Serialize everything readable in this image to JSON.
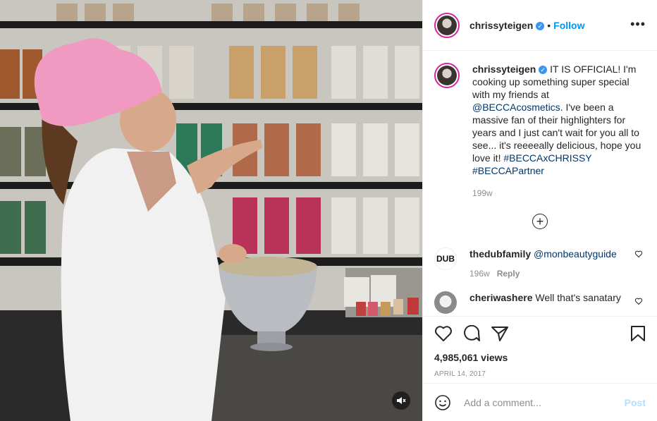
{
  "header": {
    "username": "chrissyteigen",
    "separator": "•",
    "follow_label": "Follow",
    "more_label": "•••"
  },
  "caption": {
    "username": "chrissyteigen",
    "text_1": "IT IS OFFICIAL! I'm cooking up something super special with my friends at ",
    "mention": "@BECCAcosmetics",
    "text_2": ". I've been a massive fan of their highlighters for years and I just can't wait for you all to see... it's reeeeally delicious, hope you love it!",
    "hashtag_1": "#BECCAxCHRISSY",
    "hashtag_2": "#BECCAPartner",
    "time": "199w"
  },
  "load_more_label": "+",
  "comments": [
    {
      "username": "thedubfamily",
      "avatar_text": "DUB",
      "mention": "@monbeautyguide",
      "time": "196w",
      "reply_label": "Reply"
    },
    {
      "username": "cheriwashere",
      "text": "Well that's sanatary"
    }
  ],
  "stats": {
    "views": "4,985,061 views",
    "date": "APRIL 14, 2017"
  },
  "add_comment": {
    "placeholder": "Add a comment...",
    "post_label": "Post"
  },
  "colors": {
    "accent": "#0095f6",
    "verified": "#3897f0",
    "muted": "#8e8e8e",
    "post_disabled": "#b2dffc"
  },
  "icons": [
    "verified-badge-icon",
    "more-icon",
    "load-more-icon",
    "heart-icon",
    "comment-icon",
    "share-icon",
    "bookmark-icon",
    "emoji-icon",
    "mute-icon"
  ]
}
